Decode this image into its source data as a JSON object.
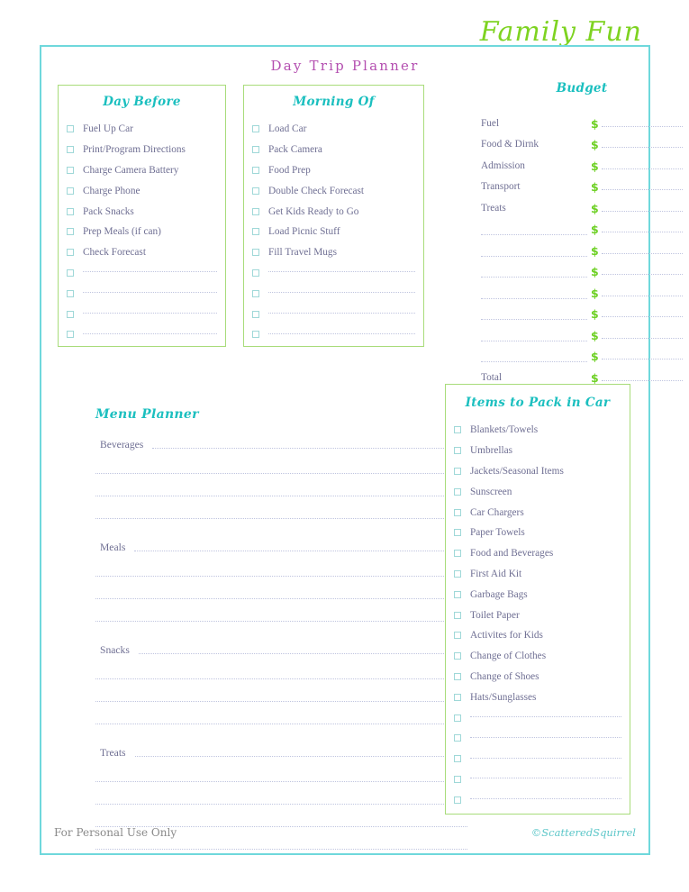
{
  "brand": "Family Fun",
  "doc_title": "Day Trip Planner",
  "colors": {
    "frame": "#6FD8DC",
    "card_border": "#A8DC7A",
    "heading_teal": "#1BBFBF",
    "title_purple": "#B44FB0",
    "brand_green": "#7ED321",
    "dollar_green": "#6DD023",
    "body_text": "#6F6F93",
    "dotted_line": "#BFC4DF",
    "checkbox": "#9FD8D8"
  },
  "day_before": {
    "title": "Day Before",
    "items": [
      "Fuel Up Car",
      "Print/Program Directions",
      "Charge Camera Battery",
      "Charge Phone",
      "Pack Snacks",
      "Prep Meals (if can)",
      "Check Forecast"
    ],
    "blank_rows": 4
  },
  "morning_of": {
    "title": "Morning Of",
    "items": [
      "Load Car",
      "Pack Camera",
      "Food Prep",
      "Double Check Forecast",
      "Get Kids Ready to Go",
      "Load Picnic Stuff",
      "Fill Travel Mugs"
    ],
    "blank_rows": 4
  },
  "budget": {
    "title": "Budget",
    "currency_symbol": "$",
    "items": [
      "Fuel",
      "Food & Dirnk",
      "Admission",
      "Transport",
      "Treats"
    ],
    "blank_rows": 7,
    "total_label": "Total"
  },
  "menu_planner": {
    "title": "Menu Planner",
    "groups": [
      {
        "label": "Beverages",
        "blank_lines": 3
      },
      {
        "label": "Meals",
        "blank_lines": 3
      },
      {
        "label": "Snacks",
        "blank_lines": 3
      },
      {
        "label": "Treats",
        "blank_lines": 4
      }
    ]
  },
  "items_to_pack": {
    "title": "Items to Pack in Car",
    "items": [
      "Blankets/Towels",
      "Umbrellas",
      "Jackets/Seasonal Items",
      "Sunscreen",
      "Car Chargers",
      "Paper Towels",
      "Food and Beverages",
      "First Aid Kit",
      "Garbage Bags",
      "Toilet Paper",
      "Activites for Kids",
      "Change of Clothes",
      "Change of Shoes",
      "Hats/Sunglasses"
    ],
    "blank_rows": 5
  },
  "footer": {
    "left": "For Personal Use Only",
    "right": "©ScatteredSquirrel"
  }
}
